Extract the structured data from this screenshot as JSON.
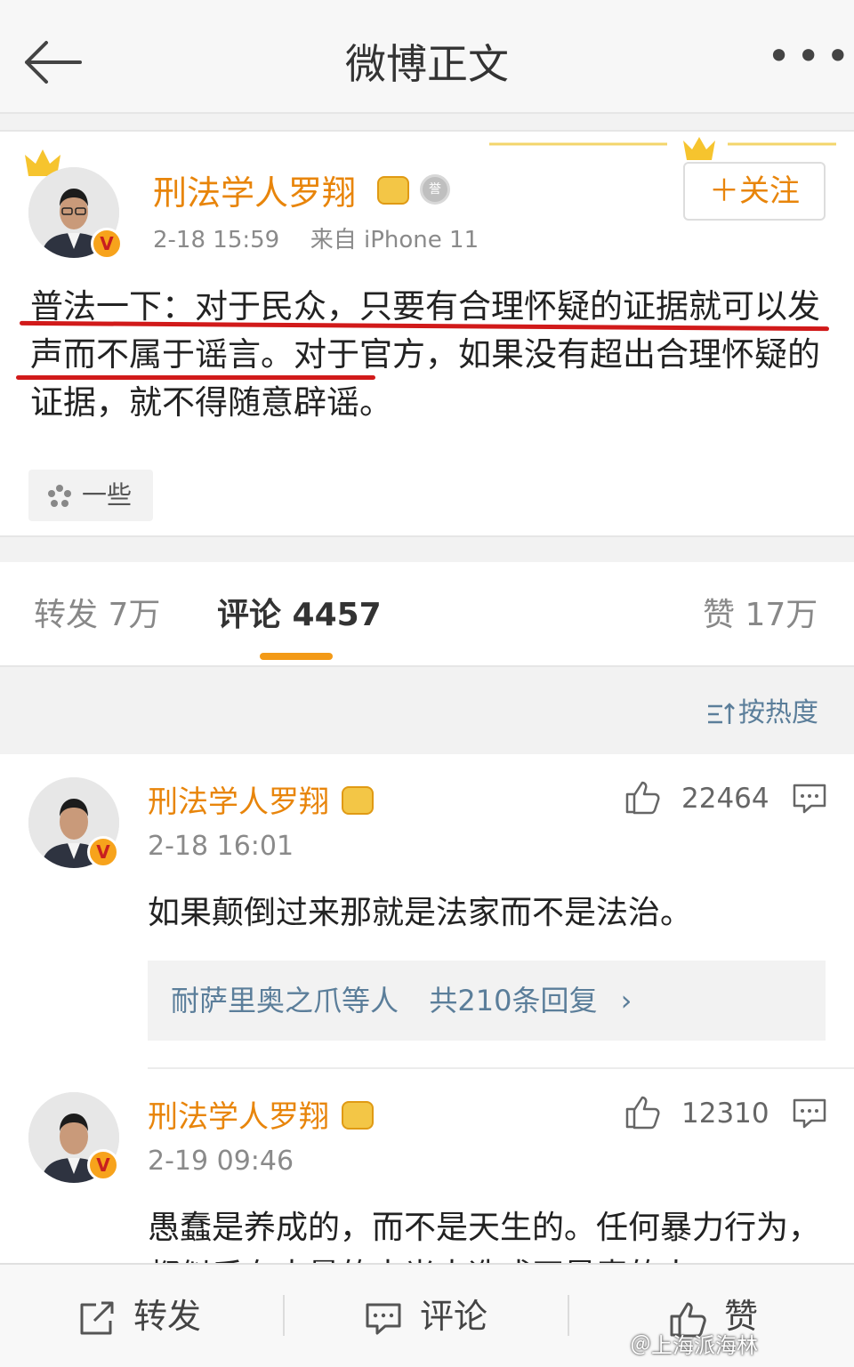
{
  "header": {
    "title": "微博正文",
    "more": "•••"
  },
  "post": {
    "author": "刑法学人罗翔",
    "verified_badge": "V",
    "medal_text": "誉",
    "time": "2-18 15:59",
    "source": "来自 iPhone 11",
    "follow_label": "＋关注",
    "text": "普法一下：对于民众，只要有合理怀疑的证据就可以发声而不属于谣言。对于官方，如果没有超出合理怀疑的证据，就不得随意辟谣。",
    "tag_label": "一些",
    "accent_color": "#e8850b",
    "underline_color": "#d11a1a"
  },
  "tabs": {
    "repost": "转发 7万",
    "comments": "评论 4457",
    "likes": "赞 17万"
  },
  "sort_label": "按热度",
  "comments": [
    {
      "author": "刑法学人罗翔",
      "time": "2-18 16:01",
      "likes": "22464",
      "text": "如果颠倒过来那就是法家而不是法治。",
      "replies_users": "耐萨里奥之爪等人",
      "replies_count": "共210条回复",
      "replies_arrow": "›"
    },
    {
      "author": "刑法学人罗翔",
      "time": "2-19 09:46",
      "likes": "12310",
      "text": "愚蠢是养成的，而不是天生的。任何暴力行为，都似乎有大量的古光大造成正是毒的人"
    }
  ],
  "bottom_bar": {
    "repost": "转发",
    "comment": "评论",
    "like": "赞"
  },
  "watermark": "＠上海派海林"
}
